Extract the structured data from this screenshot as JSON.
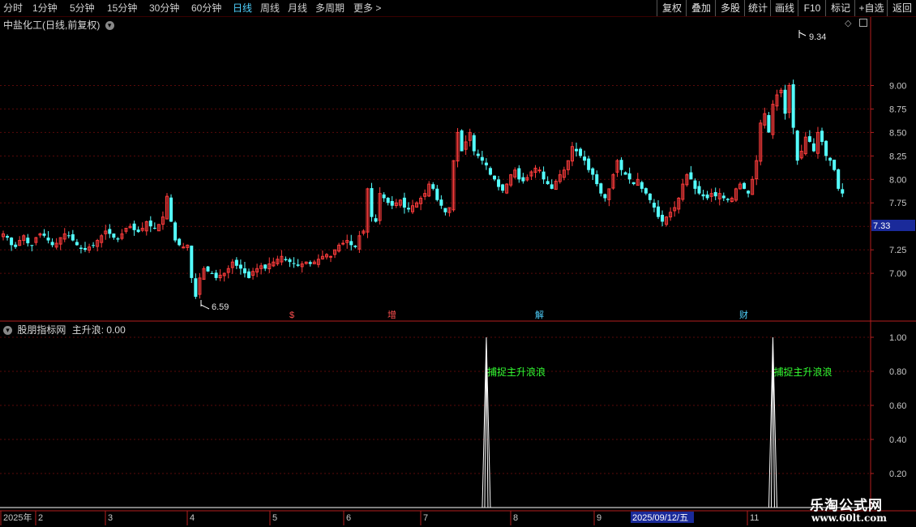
{
  "toolbar": {
    "periods": [
      "分时",
      "1分钟",
      "5分钟",
      "15分钟",
      "30分钟",
      "60分钟",
      "日线",
      "周线",
      "月线",
      "多周期",
      "更多"
    ],
    "more_arrow": ">",
    "active_period": "日线",
    "right_buttons": [
      "复权",
      "叠加",
      "多股",
      "统计",
      "画线",
      "F10",
      "标记",
      "+自选",
      "返回"
    ]
  },
  "main_panel": {
    "title": "中盐化工(日线,前复权)",
    "price_axis": [
      "9.00",
      "8.75",
      "8.50",
      "8.25",
      "8.00",
      "7.75",
      "7.50",
      "7.25",
      "7.00"
    ],
    "current_price": "7.33",
    "high_label": "9.34",
    "low_label": "6.59",
    "events": [
      {
        "label": "$",
        "color": "#ff5050"
      },
      {
        "label": "增",
        "color": "#ff5050"
      },
      {
        "label": "解",
        "color": "#4fd2ff"
      },
      {
        "label": "财",
        "color": "#4fd2ff"
      }
    ]
  },
  "indicator_panel": {
    "title": "股朋指标网",
    "series_name": "主升浪",
    "series_value": "0.00",
    "axis": [
      "1.00",
      "0.80",
      "0.60",
      "0.40",
      "0.20"
    ],
    "signal_label": "捕捉主升浪浪",
    "spikes": [
      {
        "index": 119,
        "value": 1.0
      },
      {
        "index": 189,
        "value": 1.0
      }
    ]
  },
  "time_axis": {
    "labels": [
      "2025年",
      "2",
      "3",
      "4",
      "5",
      "6",
      "7",
      "8",
      "9",
      "11"
    ],
    "cursor_label": "2025/09/12/五"
  },
  "watermark": {
    "line1": "乐淘公式网",
    "line2": "www.60lt.com"
  },
  "colors": {
    "up": "#ff3c3c",
    "down": "#54ffff",
    "spike": "#ffffff",
    "signal": "#33ff33",
    "axis": "#b41e1e",
    "grid": "#5a0a0a"
  },
  "chart_data": {
    "type": "candlestick",
    "y_range_main": [
      6.5,
      9.6
    ],
    "y_range_indicator": [
      0,
      1.0
    ],
    "closes": [
      7.42,
      7.38,
      7.3,
      7.28,
      7.35,
      7.4,
      7.32,
      7.3,
      7.38,
      7.42,
      7.4,
      7.35,
      7.3,
      7.32,
      7.38,
      7.42,
      7.4,
      7.35,
      7.3,
      7.26,
      7.25,
      7.28,
      7.3,
      7.35,
      7.4,
      7.45,
      7.42,
      7.38,
      7.36,
      7.42,
      7.48,
      7.5,
      7.46,
      7.44,
      7.48,
      7.55,
      7.5,
      7.48,
      7.52,
      7.6,
      7.82,
      7.55,
      7.35,
      7.3,
      7.28,
      7.3,
      6.95,
      6.75,
      6.95,
      7.05,
      7.02,
      7.0,
      6.95,
      6.98,
      7.0,
      7.05,
      7.12,
      7.08,
      7.05,
      7.0,
      6.95,
      7.02,
      7.05,
      7.08,
      7.05,
      7.1,
      7.12,
      7.15,
      7.18,
      7.14,
      7.12,
      7.1,
      7.08,
      7.1,
      7.12,
      7.1,
      7.12,
      7.15,
      7.18,
      7.2,
      7.18,
      7.25,
      7.3,
      7.32,
      7.35,
      7.3,
      7.28,
      7.4,
      7.45,
      7.9,
      7.6,
      7.55,
      7.85,
      7.8,
      7.75,
      7.72,
      7.75,
      7.78,
      7.7,
      7.68,
      7.72,
      7.75,
      7.8,
      7.85,
      7.95,
      7.9,
      7.78,
      7.72,
      7.65,
      7.7,
      8.2,
      8.5,
      8.3,
      8.4,
      8.5,
      8.3,
      8.25,
      8.2,
      8.15,
      8.05,
      8.0,
      7.92,
      7.88,
      7.95,
      8.05,
      8.1,
      8.0,
      7.98,
      8.02,
      8.08,
      8.12,
      8.1,
      8.0,
      7.95,
      7.9,
      7.98,
      8.05,
      8.1,
      8.2,
      8.35,
      8.3,
      8.25,
      8.2,
      8.1,
      8.05,
      7.95,
      7.85,
      7.8,
      7.9,
      8.05,
      8.2,
      8.1,
      8.05,
      8.0,
      7.95,
      8.0,
      7.9,
      7.85,
      7.78,
      7.7,
      7.6,
      7.55,
      7.6,
      7.65,
      7.7,
      7.8,
      7.95,
      8.05,
      8.0,
      7.9,
      7.85,
      7.82,
      7.8,
      7.85,
      7.82,
      7.85,
      7.8,
      7.78,
      7.8,
      7.9,
      7.95,
      7.9,
      7.85,
      8.0,
      8.2,
      8.6,
      8.7,
      8.5,
      8.8,
      8.9,
      8.95,
      8.7,
      9.0,
      8.55,
      8.2,
      8.3,
      8.45,
      8.4,
      8.3,
      8.5,
      8.4,
      8.25,
      8.2,
      8.1,
      7.9,
      7.85
    ]
  }
}
